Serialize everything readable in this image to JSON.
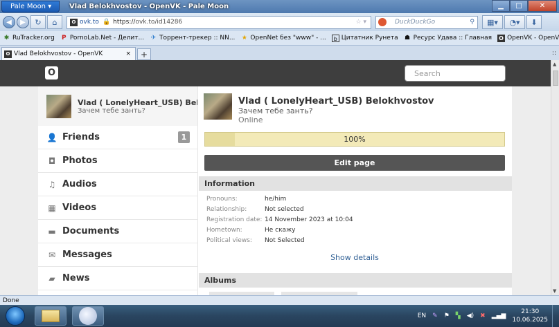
{
  "browser": {
    "app_button": "Pale Moon",
    "window_title": "Vlad Belokhvostov - OpenVK - Pale Moon",
    "url_host": "ovk.to",
    "url_prefix": "https://",
    "url_rest": "ovk.to/id14286",
    "search_engine": "DuckDuckGo",
    "status": "Done"
  },
  "bookmarks": [
    {
      "label": "RuTracker.org",
      "icon": "rutracker-icon"
    },
    {
      "label": "PornoLab.Net - Делит...",
      "icon": "pornolab-icon"
    },
    {
      "label": "Торрент-трекер :: NN...",
      "icon": "nnm-icon"
    },
    {
      "label": "OpenNet без \"www\" - ...",
      "icon": "opennet-icon"
    },
    {
      "label": "Цитатник Рунета",
      "icon": "bash-icon"
    },
    {
      "label": "Ресурс Удава :: Главная",
      "icon": "udav-icon"
    },
    {
      "label": "OpenVK - OpenVK",
      "icon": "openvk-icon"
    }
  ],
  "tab": {
    "label": "Vlad Belokhvostov - OpenVK",
    "close": "×",
    "new": "+"
  },
  "site": {
    "logo": "O",
    "search_placeholder": "Search",
    "sidebar_profile": {
      "name": "Vlad ( LonelyHeart_USB) Belokhvostov",
      "status": "Зачем тебе занть?"
    },
    "menu": [
      {
        "label": "Friends",
        "icon": "person-icon",
        "badge": "1"
      },
      {
        "label": "Photos",
        "icon": "camera-icon"
      },
      {
        "label": "Audios",
        "icon": "music-note-icon"
      },
      {
        "label": "Videos",
        "icon": "film-icon"
      },
      {
        "label": "Documents",
        "icon": "document-icon"
      },
      {
        "label": "Messages",
        "icon": "envelope-icon"
      },
      {
        "label": "News",
        "icon": "speech-bubble-icon"
      }
    ],
    "profile": {
      "name": "Vlad ( LonelyHeart_USB) Belokhvostov",
      "status": "Зачем тебе занть?",
      "online": "Online",
      "completion_label": "100%",
      "completion": 0.1,
      "edit_button": "Edit page",
      "information_header": "Information",
      "info": [
        {
          "key": "Pronouns:",
          "value": "he/him"
        },
        {
          "key": "Relationship:",
          "value": "Not selected"
        },
        {
          "key": "Registration date:",
          "value": "14 November 2023 at 10:04"
        },
        {
          "key": "Hometown:",
          "value": "Не скажу"
        },
        {
          "key": "Political views:",
          "value": "Not Selected"
        }
      ],
      "show_details": "Show details",
      "albums_header": "Albums"
    }
  },
  "taskbar": {
    "lang": "EN",
    "time": "21:30",
    "date": "10.06.2025"
  }
}
